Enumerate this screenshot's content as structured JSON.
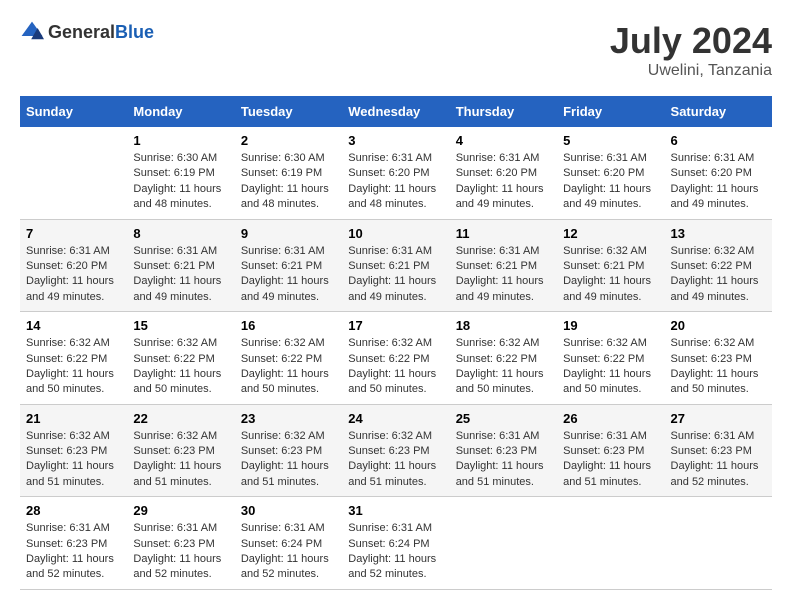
{
  "header": {
    "logo_general": "General",
    "logo_blue": "Blue",
    "title": "July 2024",
    "subtitle": "Uwelini, Tanzania"
  },
  "calendar": {
    "days_of_week": [
      "Sunday",
      "Monday",
      "Tuesday",
      "Wednesday",
      "Thursday",
      "Friday",
      "Saturday"
    ],
    "weeks": [
      [
        {
          "day": "",
          "sunrise": "",
          "sunset": "",
          "daylight": ""
        },
        {
          "day": "1",
          "sunrise": "Sunrise: 6:30 AM",
          "sunset": "Sunset: 6:19 PM",
          "daylight": "Daylight: 11 hours and 48 minutes."
        },
        {
          "day": "2",
          "sunrise": "Sunrise: 6:30 AM",
          "sunset": "Sunset: 6:19 PM",
          "daylight": "Daylight: 11 hours and 48 minutes."
        },
        {
          "day": "3",
          "sunrise": "Sunrise: 6:31 AM",
          "sunset": "Sunset: 6:20 PM",
          "daylight": "Daylight: 11 hours and 48 minutes."
        },
        {
          "day": "4",
          "sunrise": "Sunrise: 6:31 AM",
          "sunset": "Sunset: 6:20 PM",
          "daylight": "Daylight: 11 hours and 49 minutes."
        },
        {
          "day": "5",
          "sunrise": "Sunrise: 6:31 AM",
          "sunset": "Sunset: 6:20 PM",
          "daylight": "Daylight: 11 hours and 49 minutes."
        },
        {
          "day": "6",
          "sunrise": "Sunrise: 6:31 AM",
          "sunset": "Sunset: 6:20 PM",
          "daylight": "Daylight: 11 hours and 49 minutes."
        }
      ],
      [
        {
          "day": "7",
          "sunrise": "Sunrise: 6:31 AM",
          "sunset": "Sunset: 6:20 PM",
          "daylight": "Daylight: 11 hours and 49 minutes."
        },
        {
          "day": "8",
          "sunrise": "Sunrise: 6:31 AM",
          "sunset": "Sunset: 6:21 PM",
          "daylight": "Daylight: 11 hours and 49 minutes."
        },
        {
          "day": "9",
          "sunrise": "Sunrise: 6:31 AM",
          "sunset": "Sunset: 6:21 PM",
          "daylight": "Daylight: 11 hours and 49 minutes."
        },
        {
          "day": "10",
          "sunrise": "Sunrise: 6:31 AM",
          "sunset": "Sunset: 6:21 PM",
          "daylight": "Daylight: 11 hours and 49 minutes."
        },
        {
          "day": "11",
          "sunrise": "Sunrise: 6:31 AM",
          "sunset": "Sunset: 6:21 PM",
          "daylight": "Daylight: 11 hours and 49 minutes."
        },
        {
          "day": "12",
          "sunrise": "Sunrise: 6:32 AM",
          "sunset": "Sunset: 6:21 PM",
          "daylight": "Daylight: 11 hours and 49 minutes."
        },
        {
          "day": "13",
          "sunrise": "Sunrise: 6:32 AM",
          "sunset": "Sunset: 6:22 PM",
          "daylight": "Daylight: 11 hours and 49 minutes."
        }
      ],
      [
        {
          "day": "14",
          "sunrise": "Sunrise: 6:32 AM",
          "sunset": "Sunset: 6:22 PM",
          "daylight": "Daylight: 11 hours and 50 minutes."
        },
        {
          "day": "15",
          "sunrise": "Sunrise: 6:32 AM",
          "sunset": "Sunset: 6:22 PM",
          "daylight": "Daylight: 11 hours and 50 minutes."
        },
        {
          "day": "16",
          "sunrise": "Sunrise: 6:32 AM",
          "sunset": "Sunset: 6:22 PM",
          "daylight": "Daylight: 11 hours and 50 minutes."
        },
        {
          "day": "17",
          "sunrise": "Sunrise: 6:32 AM",
          "sunset": "Sunset: 6:22 PM",
          "daylight": "Daylight: 11 hours and 50 minutes."
        },
        {
          "day": "18",
          "sunrise": "Sunrise: 6:32 AM",
          "sunset": "Sunset: 6:22 PM",
          "daylight": "Daylight: 11 hours and 50 minutes."
        },
        {
          "day": "19",
          "sunrise": "Sunrise: 6:32 AM",
          "sunset": "Sunset: 6:22 PM",
          "daylight": "Daylight: 11 hours and 50 minutes."
        },
        {
          "day": "20",
          "sunrise": "Sunrise: 6:32 AM",
          "sunset": "Sunset: 6:23 PM",
          "daylight": "Daylight: 11 hours and 50 minutes."
        }
      ],
      [
        {
          "day": "21",
          "sunrise": "Sunrise: 6:32 AM",
          "sunset": "Sunset: 6:23 PM",
          "daylight": "Daylight: 11 hours and 51 minutes."
        },
        {
          "day": "22",
          "sunrise": "Sunrise: 6:32 AM",
          "sunset": "Sunset: 6:23 PM",
          "daylight": "Daylight: 11 hours and 51 minutes."
        },
        {
          "day": "23",
          "sunrise": "Sunrise: 6:32 AM",
          "sunset": "Sunset: 6:23 PM",
          "daylight": "Daylight: 11 hours and 51 minutes."
        },
        {
          "day": "24",
          "sunrise": "Sunrise: 6:32 AM",
          "sunset": "Sunset: 6:23 PM",
          "daylight": "Daylight: 11 hours and 51 minutes."
        },
        {
          "day": "25",
          "sunrise": "Sunrise: 6:31 AM",
          "sunset": "Sunset: 6:23 PM",
          "daylight": "Daylight: 11 hours and 51 minutes."
        },
        {
          "day": "26",
          "sunrise": "Sunrise: 6:31 AM",
          "sunset": "Sunset: 6:23 PM",
          "daylight": "Daylight: 11 hours and 51 minutes."
        },
        {
          "day": "27",
          "sunrise": "Sunrise: 6:31 AM",
          "sunset": "Sunset: 6:23 PM",
          "daylight": "Daylight: 11 hours and 52 minutes."
        }
      ],
      [
        {
          "day": "28",
          "sunrise": "Sunrise: 6:31 AM",
          "sunset": "Sunset: 6:23 PM",
          "daylight": "Daylight: 11 hours and 52 minutes."
        },
        {
          "day": "29",
          "sunrise": "Sunrise: 6:31 AM",
          "sunset": "Sunset: 6:23 PM",
          "daylight": "Daylight: 11 hours and 52 minutes."
        },
        {
          "day": "30",
          "sunrise": "Sunrise: 6:31 AM",
          "sunset": "Sunset: 6:24 PM",
          "daylight": "Daylight: 11 hours and 52 minutes."
        },
        {
          "day": "31",
          "sunrise": "Sunrise: 6:31 AM",
          "sunset": "Sunset: 6:24 PM",
          "daylight": "Daylight: 11 hours and 52 minutes."
        },
        {
          "day": "",
          "sunrise": "",
          "sunset": "",
          "daylight": ""
        },
        {
          "day": "",
          "sunrise": "",
          "sunset": "",
          "daylight": ""
        },
        {
          "day": "",
          "sunrise": "",
          "sunset": "",
          "daylight": ""
        }
      ]
    ]
  }
}
